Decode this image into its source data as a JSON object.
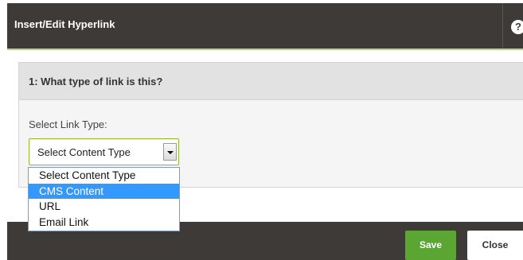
{
  "dialog": {
    "title": "Insert/Edit Hyperlink",
    "help_icon": "?"
  },
  "section": {
    "title": "1: What type of link is this?",
    "field_label": "Select Link Type:"
  },
  "link_type_select": {
    "selected_value": "Select Content Type",
    "options": [
      "Select Content Type",
      "CMS Content",
      "URL",
      "Email Link"
    ],
    "highlighted_option": "CMS Content"
  },
  "footer": {
    "save_label": "Save",
    "close_label": "Close"
  },
  "colors": {
    "titlebar": "#3d3a38",
    "accent_green": "#5ba632",
    "highlight": "#3399ff"
  }
}
